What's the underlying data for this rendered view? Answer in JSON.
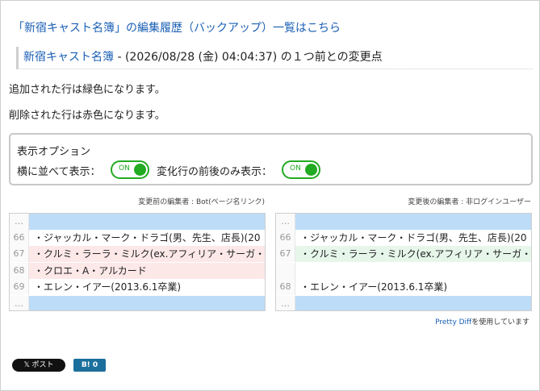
{
  "history_link": "「新宿キャスト名簿」の編集履歴（バックアップ）一覧はこちら",
  "heading": {
    "page_name": "新宿キャスト名簿",
    "rest": " - (2026/08/28 (金) 04:04:37) の１つ前との変更点"
  },
  "notes": {
    "added": "追加された行は緑色になります。",
    "removed": "削除された行は赤色になります。"
  },
  "options": {
    "title": "表示オプション",
    "side_by_side_label": "横に並べて表示：",
    "changed_only_label": "変化行の前後のみ表示：",
    "toggle_on": "ON"
  },
  "left_pane": {
    "caption": "変更前の編集者 : Bot(ページ名リンク)",
    "rows": [
      {
        "num": "…",
        "text": "",
        "type": "skip"
      },
      {
        "num": "66",
        "text": "・ジャッカル・マーク・ドラゴ(男、先生、店長)(20",
        "type": "normal"
      },
      {
        "num": "67",
        "text": "・クルミ・ラーラ・ミルク(ex.アフィリア・サーガ・",
        "type": "removed"
      },
      {
        "num": "68",
        "text": "・クロエ・A・アルカード",
        "type": "removed"
      },
      {
        "num": "69",
        "text": "・エレン・イアー(2013.6.1卒業)",
        "type": "normal"
      },
      {
        "num": "…",
        "text": "",
        "type": "skip"
      }
    ]
  },
  "right_pane": {
    "caption": "変更後の編集者 : 非ログインユーザー",
    "rows": [
      {
        "num": "…",
        "text": "",
        "type": "skip"
      },
      {
        "num": "66",
        "text": "・ジャッカル・マーク・ドラゴ(男、先生、店長)(20",
        "type": "normal"
      },
      {
        "num": "67",
        "text": "・クルミ・ラーラ・ミルク(ex.アフィリア・サーガ・",
        "type": "added"
      },
      {
        "num": "",
        "text": "",
        "type": "blank"
      },
      {
        "num": "68",
        "text": "・エレン・イアー(2013.6.1卒業)",
        "type": "normal"
      },
      {
        "num": "…",
        "text": "",
        "type": "skip"
      }
    ]
  },
  "credit": {
    "link": "Pretty Diff",
    "rest": "を使用しています"
  },
  "share": {
    "x_label": "𝕏 ポスト",
    "hatena_label": "B! 0"
  }
}
